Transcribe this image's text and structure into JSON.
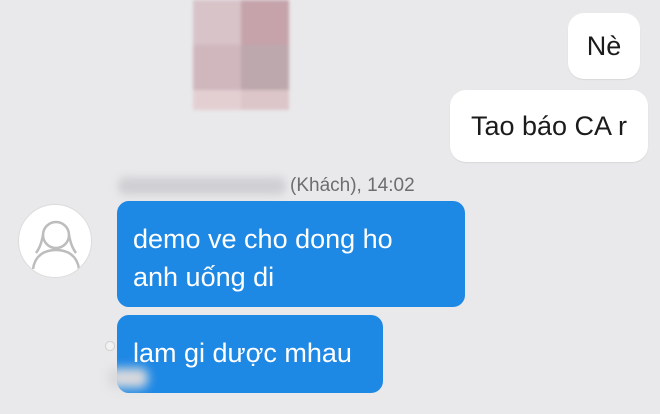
{
  "thread": {
    "outgoing": [
      {
        "text": "Nè"
      },
      {
        "text": "Tao báo CA r"
      }
    ],
    "incoming": {
      "sender_meta": "(Khách), 14:02",
      "messages": [
        {
          "line1": "demo ve cho dong ho",
          "line2": "anh uống di"
        },
        {
          "text": "lam gi dược mhau"
        }
      ]
    }
  },
  "colors": {
    "background": "#e9e9eb",
    "incoming_bubble": "#1e88e5",
    "outgoing_bubble": "#ffffff"
  },
  "icons": {
    "avatar": "user-silhouette-icon"
  }
}
